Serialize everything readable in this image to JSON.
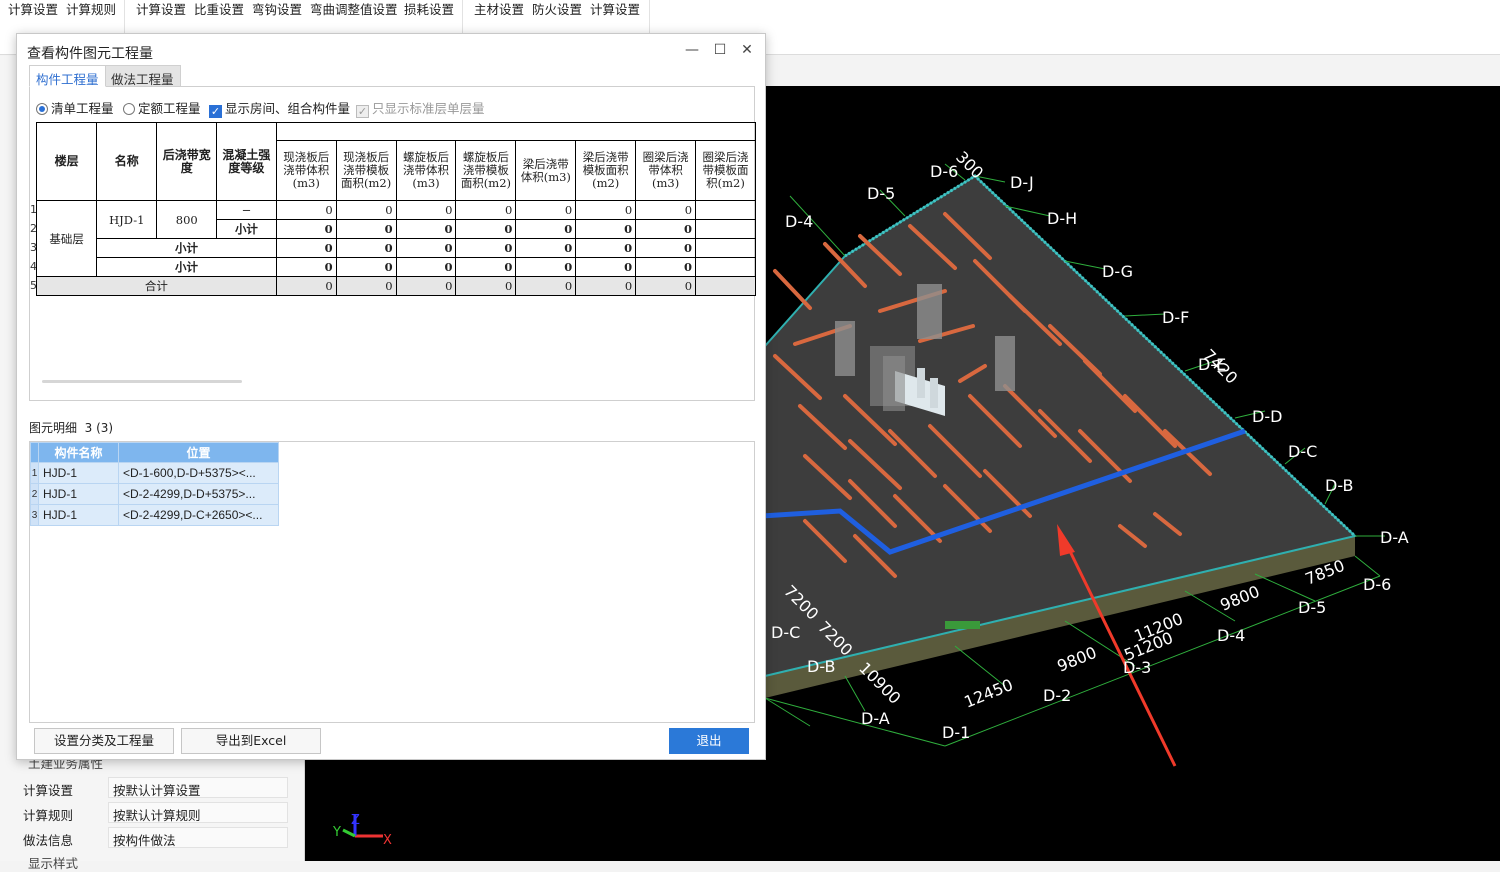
{
  "toolbar": {
    "groups": [
      [
        "计算设置",
        "计算规则"
      ],
      [
        "计算设置",
        "比重设置",
        "弯钩设置",
        "弯曲调整值设置",
        "损耗设置"
      ],
      [
        "主材设置",
        "防火设置",
        "计算设置"
      ]
    ]
  },
  "left_panel": {
    "section_title": "土建业务属性",
    "rows": [
      {
        "key": "计算设置",
        "value": "按默认计算设置"
      },
      {
        "key": "计算规则",
        "value": "按默认计算规则"
      },
      {
        "key": "做法信息",
        "value": "按构件做法"
      }
    ],
    "next_section": "显示样式"
  },
  "dialog": {
    "title": "查看构件图元工程量",
    "tabs": [
      "构件工程量",
      "做法工程量"
    ],
    "options": {
      "radio_list": "清单工程量",
      "radio_quota": "定额工程量",
      "check_rooms": "显示房间、组合构件量",
      "check_standard": "只显示标准层单层量"
    },
    "table": {
      "headers": [
        "楼层",
        "名称",
        "后浇带宽度",
        "混凝土强度等级",
        "现浇板后浇带体积(m3)",
        "现浇板后浇带模板面积(m2)",
        "螺旋板后浇带体积(m3)",
        "螺旋板后浇带模板面积(m2)",
        "梁后浇带体积(m3)",
        "梁后浇带模板面积(m2)",
        "圈梁后浇带体积(m3)",
        "圈梁后浇带模板面积(m2)"
      ],
      "floor": "基础层",
      "name": "HJD-1",
      "width": "800",
      "grade": "−",
      "subtotal": "小计",
      "total": "合计",
      "row_numbers": [
        "1",
        "2",
        "3",
        "4",
        "5"
      ],
      "zero": "0"
    },
    "detail": {
      "label": "图元明细",
      "count": "3 (3)",
      "headers": [
        "构件名称",
        "位置"
      ],
      "rows": [
        {
          "no": "1",
          "name": "HJD-1",
          "pos": "<D-1-600,D-D+5375><..."
        },
        {
          "no": "2",
          "name": "HJD-1",
          "pos": "<D-2-4299,D-D+5375>..."
        },
        {
          "no": "3",
          "name": "HJD-1",
          "pos": "<D-2-4299,D-C+2650><..."
        }
      ]
    },
    "buttons": {
      "classify": "设置分类及工程量",
      "export": "导出到Excel",
      "exit": "退出"
    }
  },
  "viewport": {
    "grid_right": [
      "D-J",
      "D-H",
      "D-G",
      "D-F",
      "D-E",
      "D-D",
      "D-C",
      "D-B",
      "D-A"
    ],
    "grid_top": [
      "D-4",
      "D-5",
      "D-6"
    ],
    "grid_bottom": [
      "D-1",
      "D-2",
      "D-3",
      "D-4",
      "D-5",
      "D-6"
    ],
    "grid_left": [
      "D-A",
      "D-B",
      "D-C"
    ],
    "dims_bottom": [
      "12450",
      "9800",
      "11200",
      "51200",
      "9800",
      "7850"
    ],
    "dims_left": [
      "10900",
      "7200",
      "7200"
    ],
    "dims_right": [
      "7420",
      "300"
    ],
    "axes": [
      "X",
      "Y",
      "Z"
    ],
    "colors": {
      "slab": "#3d3d3d",
      "strip": "#d8683f",
      "highlight": "#1f5fe0",
      "arrow": "#f03a2a",
      "background": "#000000"
    }
  }
}
